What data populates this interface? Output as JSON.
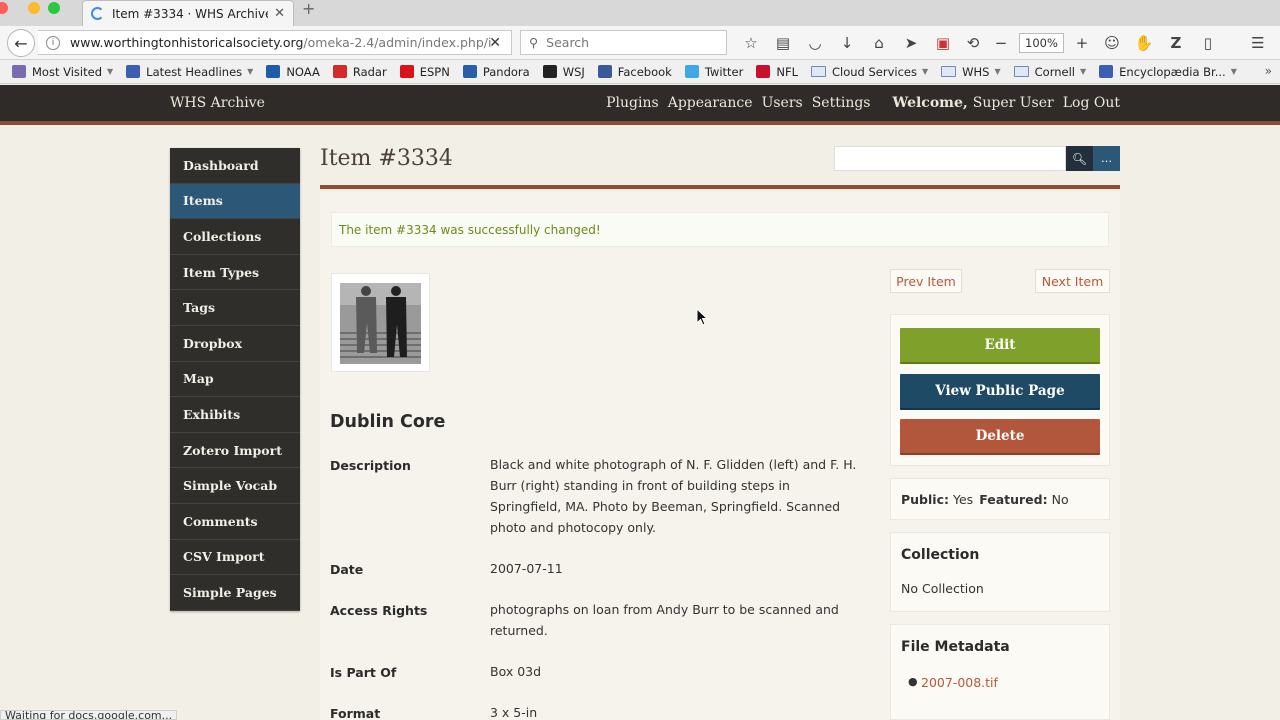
{
  "browser": {
    "tab_title": "Item #3334 · WHS Archive ...",
    "url_domain": "www.worthingtonhistoricalsociety.org",
    "url_path": "/omeka-2.4/admin/index.php/i",
    "search_placeholder": "Search",
    "zoom": "100%",
    "status_text": "Waiting for docs.google.com...",
    "bookmarks": [
      {
        "label": "Most Visited",
        "icon_color": "#7a6bb0",
        "dropdown": true
      },
      {
        "label": "Latest Headlines",
        "icon_color": "#3d5fb3",
        "dropdown": true
      },
      {
        "label": "NOAA",
        "icon_color": "#1e5ca8",
        "dropdown": false
      },
      {
        "label": "Radar",
        "icon_color": "#d32a2a",
        "dropdown": false
      },
      {
        "label": "ESPN",
        "icon_color": "#d8141a",
        "dropdown": false
      },
      {
        "label": "Pandora",
        "icon_color": "#2b5ea8",
        "dropdown": false
      },
      {
        "label": "WSJ",
        "icon_color": "#222222",
        "dropdown": false
      },
      {
        "label": "Facebook",
        "icon_color": "#3b5998",
        "dropdown": false
      },
      {
        "label": "Twitter",
        "icon_color": "#41a6e6",
        "dropdown": false
      },
      {
        "label": "NFL",
        "icon_color": "#c8102e",
        "dropdown": false
      },
      {
        "label": "Cloud Services",
        "icon_color": "folder",
        "dropdown": true
      },
      {
        "label": "WHS",
        "icon_color": "folder",
        "dropdown": true
      },
      {
        "label": "Cornell",
        "icon_color": "folder",
        "dropdown": true
      },
      {
        "label": "Encyclopædia Br...",
        "icon_color": "#3d5fb3",
        "dropdown": true
      }
    ]
  },
  "header": {
    "site_title": "WHS Archive",
    "nav": [
      "Plugins",
      "Appearance",
      "Users",
      "Settings"
    ],
    "welcome": "Welcome,",
    "user": "Super User",
    "logout": "Log Out"
  },
  "sidebar": {
    "items": [
      {
        "label": "Dashboard",
        "active": false
      },
      {
        "label": "Items",
        "active": true
      },
      {
        "label": "Collections",
        "active": false
      },
      {
        "label": "Item Types",
        "active": false
      },
      {
        "label": "Tags",
        "active": false
      },
      {
        "label": "Dropbox",
        "active": false
      },
      {
        "label": "Map",
        "active": false
      },
      {
        "label": "Exhibits",
        "active": false
      },
      {
        "label": "Zotero Import",
        "active": false
      },
      {
        "label": "Simple Vocab",
        "active": false
      },
      {
        "label": "Comments",
        "active": false
      },
      {
        "label": "CSV Import",
        "active": false
      },
      {
        "label": "Simple Pages",
        "active": false
      }
    ]
  },
  "main": {
    "title": "Item #3334",
    "flash": "The item #3334 was successfully changed!",
    "section_heading": "Dublin Core",
    "metadata": [
      {
        "label": "Description",
        "value": "Black and white photograph of N. F. Glidden (left) and F. H. Burr (right) standing in front of building steps in Springfield, MA. Photo by Beeman, Springfield. Scanned photo and photocopy only."
      },
      {
        "label": "Date",
        "value": "2007-07-11"
      },
      {
        "label": "Access Rights",
        "value": "photographs on loan from Andy Burr to be scanned and returned."
      },
      {
        "label": "Is Part Of",
        "value": "Box 03d"
      },
      {
        "label": "Format",
        "value": "3 x 5-in"
      }
    ]
  },
  "right": {
    "prev": "Prev Item",
    "next": "Next Item",
    "edit": "Edit",
    "view_public": "View Public Page",
    "delete": "Delete",
    "public_label": "Public:",
    "public_value": "Yes",
    "featured_label": "Featured:",
    "featured_value": "No",
    "collection_heading": "Collection",
    "collection_value": "No Collection",
    "files_heading": "File Metadata",
    "file_name": "2007-008.tif"
  }
}
